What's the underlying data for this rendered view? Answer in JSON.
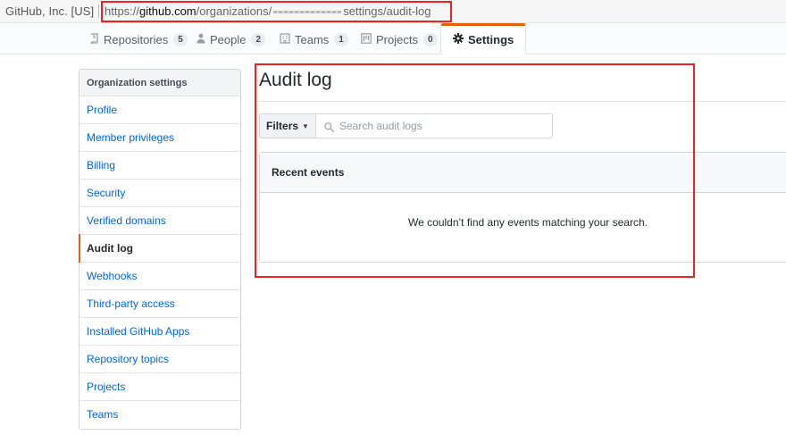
{
  "browser": {
    "site_identity": "GitHub, Inc. [US]",
    "url_scheme": "https://",
    "url_host": "github.com",
    "url_path_start": "/organizations/",
    "url_path_end": "settings/audit-log"
  },
  "org_nav": {
    "tabs": [
      {
        "label": "Repositories",
        "count": "5",
        "icon": "repo-icon"
      },
      {
        "label": "People",
        "count": "2",
        "icon": "person-icon"
      },
      {
        "label": "Teams",
        "count": "1",
        "icon": "organization-icon"
      },
      {
        "label": "Projects",
        "count": "0",
        "icon": "project-icon"
      },
      {
        "label": "Settings",
        "icon": "gear-icon",
        "selected": true
      }
    ]
  },
  "sidebar": {
    "heading": "Organization settings",
    "items": [
      {
        "label": "Profile"
      },
      {
        "label": "Member privileges"
      },
      {
        "label": "Billing"
      },
      {
        "label": "Security"
      },
      {
        "label": "Verified domains"
      },
      {
        "label": "Audit log",
        "selected": true
      },
      {
        "label": "Webhooks"
      },
      {
        "label": "Third-party access"
      },
      {
        "label": "Installed GitHub Apps"
      },
      {
        "label": "Repository topics"
      },
      {
        "label": "Projects"
      },
      {
        "label": "Teams"
      }
    ]
  },
  "main": {
    "title": "Audit log",
    "filters_label": "Filters",
    "search_placeholder": "Search audit logs",
    "search_value": "",
    "events_heading": "Recent events",
    "empty_message": "We couldn’t find any events matching your search."
  },
  "colors": {
    "link": "#0366d6",
    "selected_accent": "#e36209",
    "annotation": "#ee2222"
  }
}
